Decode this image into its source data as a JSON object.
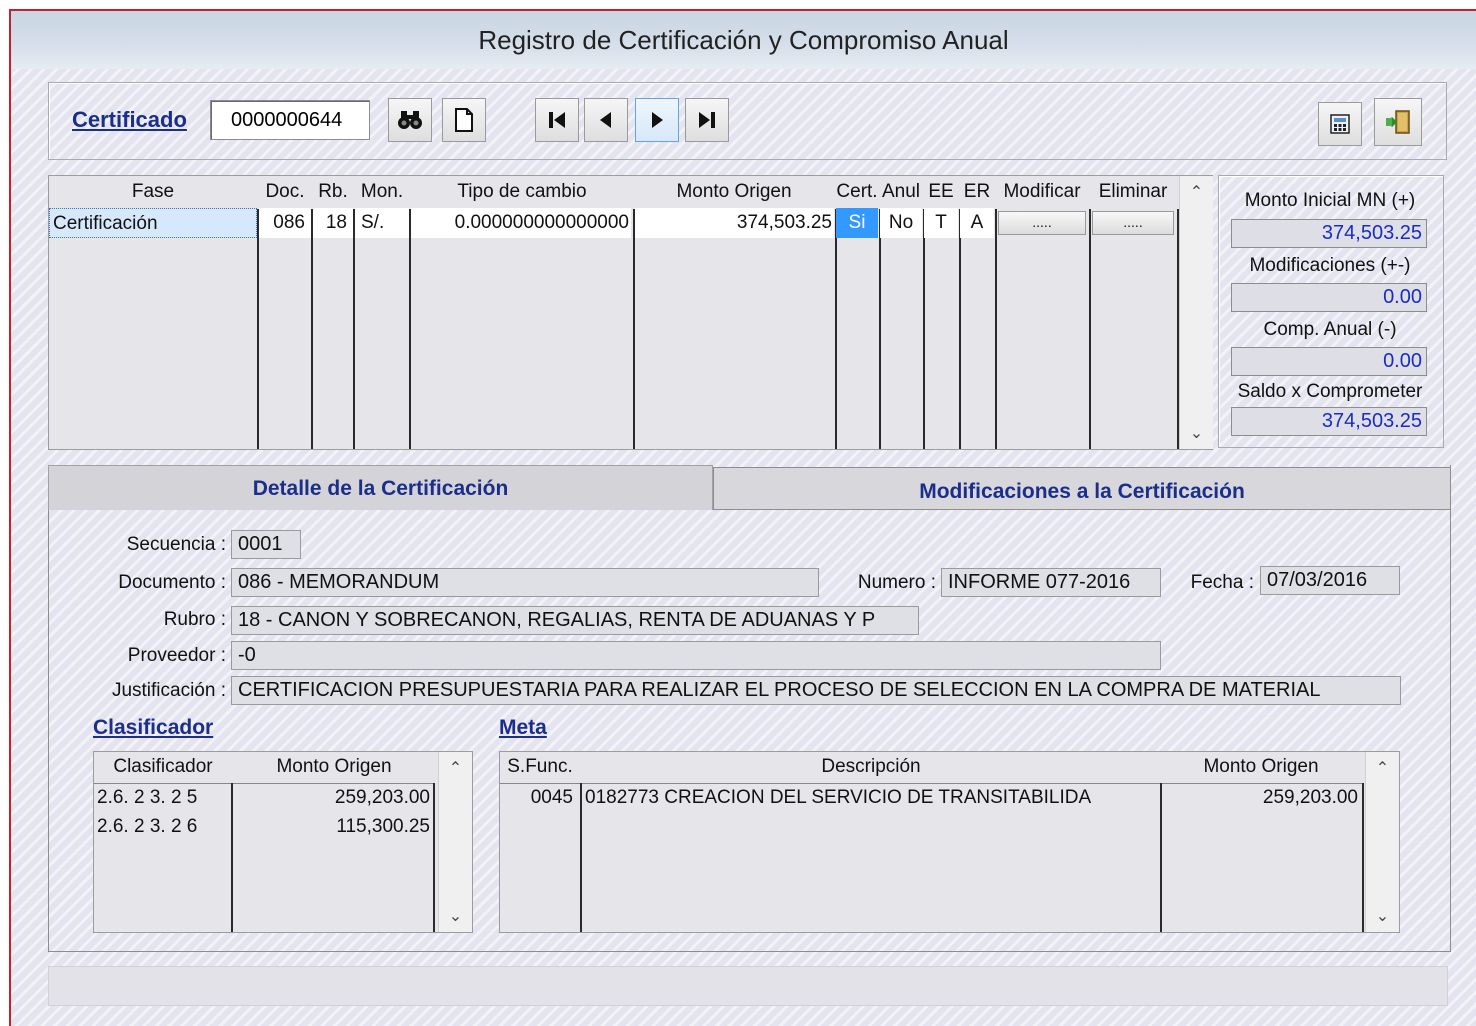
{
  "window": {
    "title": "Registro de Certificación y Compromiso Anual"
  },
  "toolbar": {
    "certificado_label": "Certificado",
    "certificado_value": "0000000644"
  },
  "grid": {
    "headers": [
      "Fase",
      "Doc.",
      "Rb.",
      "Mon.",
      "Tipo de cambio",
      "Monto Origen",
      "Cert.",
      "Anul",
      "EE",
      "ER",
      "Modificar",
      "Eliminar"
    ],
    "row": {
      "fase": "Certificación",
      "doc": "086",
      "rb": "18",
      "mon": "S/.",
      "tipo_cambio": "0.000000000000000",
      "monto_origen": "374,503.25",
      "cert": "Si",
      "anul": "No",
      "ee": "T",
      "er": "A",
      "modificar": ".....",
      "eliminar": "....."
    }
  },
  "summary": {
    "monto_inicial_label": "Monto Inicial MN (+)",
    "monto_inicial_value": "374,503.25",
    "modificaciones_label": "Modificaciones (+-)",
    "modificaciones_value": "0.00",
    "comp_anual_label": "Comp. Anual (-)",
    "comp_anual_value": "0.00",
    "saldo_label": "Saldo x Comprometer",
    "saldo_value": "374,503.25"
  },
  "tabs": {
    "detalle": "Detalle de la Certificación",
    "modificaciones": "Modificaciones a la Certificación"
  },
  "detalle": {
    "secuencia_label": "Secuencia :",
    "secuencia_value": "0001",
    "documento_label": "Documento :",
    "documento_value": "086 - MEMORANDUM",
    "numero_label": "Numero :",
    "numero_value": "INFORME 077-2016",
    "fecha_label": "Fecha :",
    "fecha_value": "07/03/2016",
    "rubro_label": "Rubro :",
    "rubro_value": "18 - CANON Y SOBRECANON, REGALIAS, RENTA DE ADUANAS Y P",
    "proveedor_label": "Proveedor :",
    "proveedor_value": "-0",
    "justificacion_label": "Justificación :",
    "justificacion_value": "CERTIFICACION PRESUPUESTARIA PARA REALIZAR EL PROCESO DE SELECCION EN LA COMPRA DE MATERIAL"
  },
  "clasificador": {
    "title": "Clasificador",
    "headers": [
      "Clasificador",
      "Monto Origen"
    ],
    "rows": [
      {
        "codigo": "2.6. 2 3. 2 5",
        "monto": "259,203.00"
      },
      {
        "codigo": "2.6. 2 3. 2 6",
        "monto": "115,300.25"
      }
    ]
  },
  "meta": {
    "title": "Meta",
    "headers": [
      "S.Func.",
      "Descripción",
      "Monto Origen"
    ],
    "rows": [
      {
        "sfunc": "0045",
        "descripcion": "0182773  CREACION DEL SERVICIO DE TRANSITABILIDA",
        "monto": "259,203.00"
      }
    ]
  },
  "colors": {
    "accent": "#1b2f8a",
    "value_blue": "#1a2cc4",
    "selection": "#3399ff"
  }
}
